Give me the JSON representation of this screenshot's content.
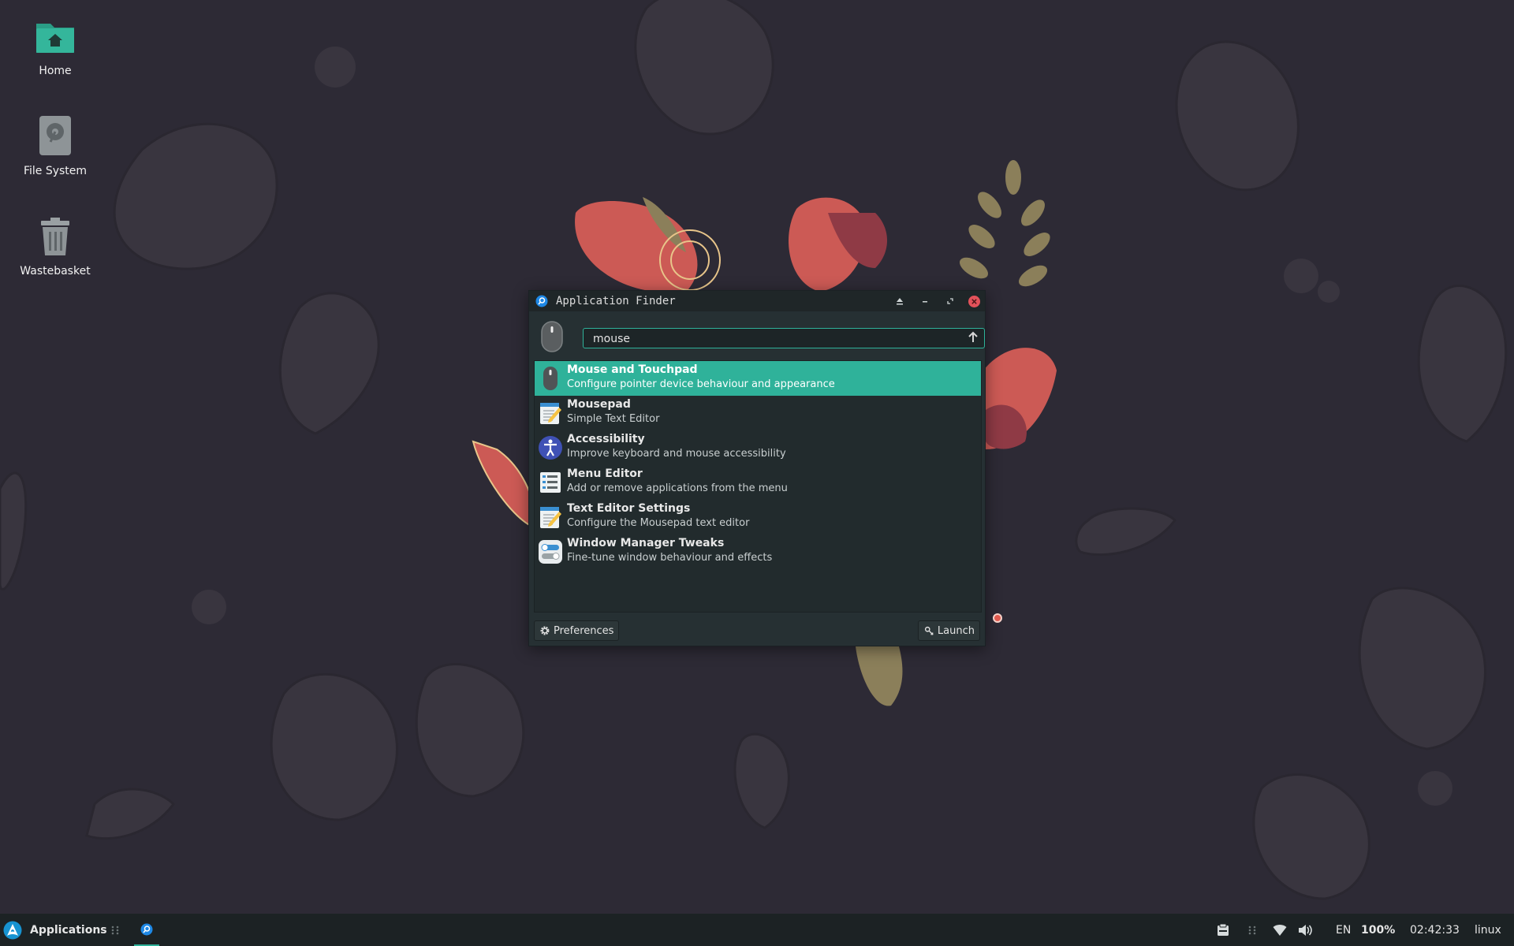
{
  "desktop": {
    "icons": [
      {
        "label": "Home"
      },
      {
        "label": "File System"
      },
      {
        "label": "Wastebasket"
      }
    ]
  },
  "window": {
    "title": "Application Finder",
    "search": {
      "value": "mouse"
    },
    "results": [
      {
        "name": "Mouse and Touchpad",
        "desc": "Configure pointer device behaviour and appearance",
        "icon": "mouse-icon",
        "selected": true
      },
      {
        "name": "Mousepad",
        "desc": "Simple Text Editor",
        "icon": "text-editor-icon"
      },
      {
        "name": "Accessibility",
        "desc": "Improve keyboard and mouse accessibility",
        "icon": "accessibility-icon"
      },
      {
        "name": "Menu Editor",
        "desc": "Add or remove applications from the menu",
        "icon": "menu-editor-icon"
      },
      {
        "name": "Text Editor Settings",
        "desc": "Configure the Mousepad text editor",
        "icon": "text-editor-icon"
      },
      {
        "name": "Window Manager Tweaks",
        "desc": "Fine-tune window behaviour and effects",
        "icon": "toggles-icon"
      }
    ],
    "preferences_label": "Preferences",
    "launch_label": "Launch"
  },
  "taskbar": {
    "applications_label": "Applications",
    "keyboard_layout": "EN",
    "battery": "100%",
    "clock": "02:42:33",
    "user": "linux"
  },
  "colors": {
    "accent": "#2fb29a",
    "desktop_bg": "#2d2a35",
    "panel_bg": "#1c2224"
  }
}
